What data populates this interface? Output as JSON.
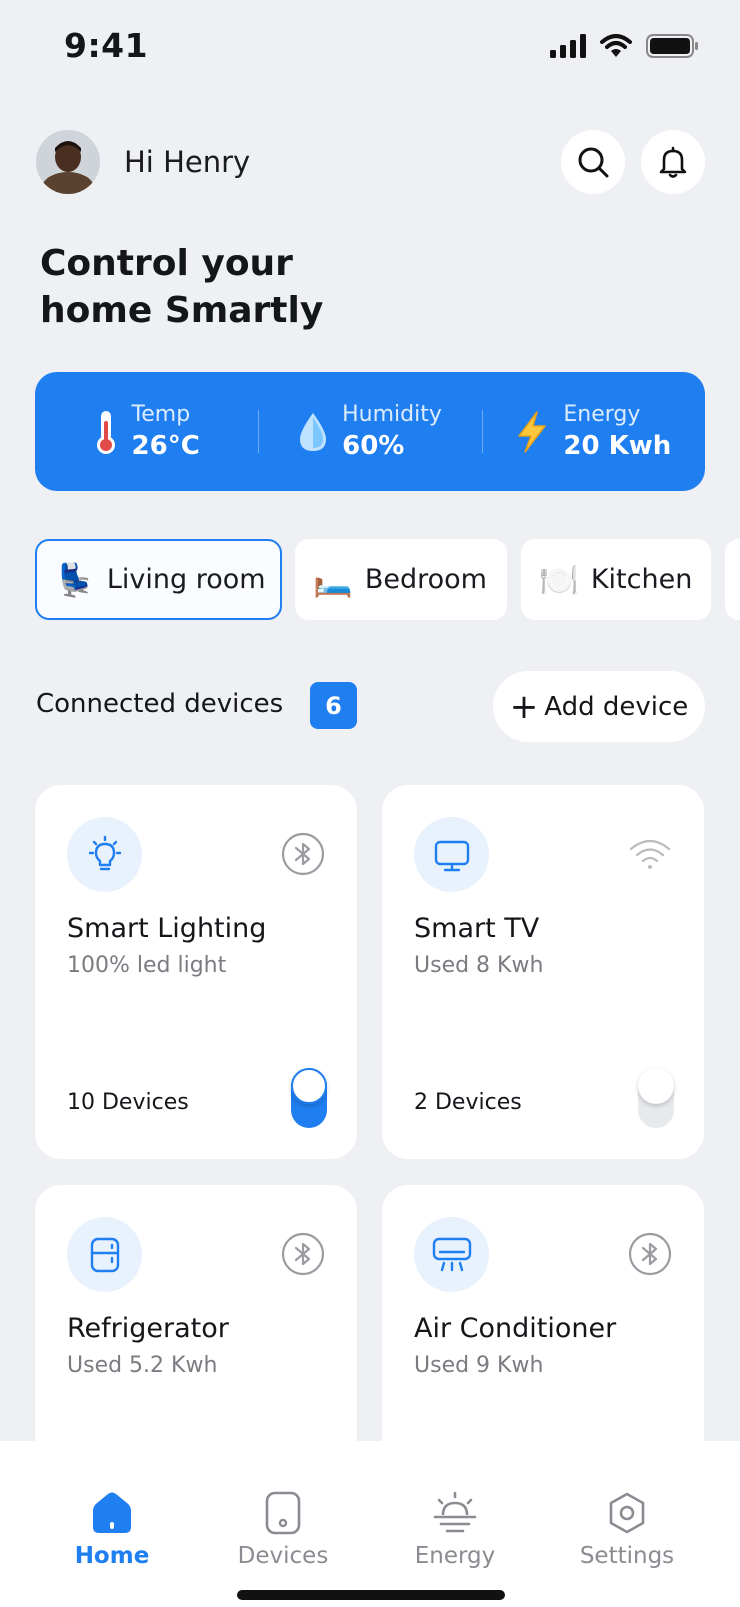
{
  "status_bar": {
    "time": "9:41",
    "icons": [
      "cellular-signal-icon",
      "wifi-icon",
      "battery-icon"
    ]
  },
  "header": {
    "greeting": "Hi Henry",
    "title_line1": "Control your",
    "title_line2": "home Smartly",
    "actions": [
      "search-icon",
      "bell-icon"
    ]
  },
  "stats": [
    {
      "icon": "thermometer-icon",
      "label": "Temp",
      "value": "26°C"
    },
    {
      "icon": "droplet-icon",
      "label": "Humidity",
      "value": "60%"
    },
    {
      "icon": "lightning-icon",
      "label": "Energy",
      "value": "20 Kwh"
    }
  ],
  "rooms": [
    {
      "label": "Living room",
      "emoji": "💺",
      "active": true
    },
    {
      "label": "Bedroom",
      "emoji": "🛏️",
      "active": false
    },
    {
      "label": "Kitchen",
      "emoji": "🍽️",
      "active": false
    }
  ],
  "connected": {
    "label": "Connected devices",
    "count": "6",
    "add_label": "Add device"
  },
  "devices": [
    {
      "name": "Smart Lighting",
      "sub": "100% led light",
      "count": "10 Devices",
      "icon": "lightbulb-icon",
      "connection": "bluetooth-icon",
      "on": true
    },
    {
      "name": "Smart TV",
      "sub": "Used 8 Kwh",
      "count": "2 Devices",
      "icon": "monitor-icon",
      "connection": "wifi-icon",
      "on": false
    },
    {
      "name": "Refrigerator",
      "sub": "Used 5.2 Kwh",
      "icon": "refrigerator-icon",
      "connection": "bluetooth-icon"
    },
    {
      "name": "Air Conditioner",
      "sub": "Used 9 Kwh",
      "icon": "air-conditioner-icon",
      "connection": "bluetooth-icon"
    }
  ],
  "nav": [
    {
      "label": "Home",
      "icon": "home-icon",
      "active": true
    },
    {
      "label": "Devices",
      "icon": "phone-device-icon",
      "active": false
    },
    {
      "label": "Energy",
      "icon": "sunrise-icon",
      "active": false
    },
    {
      "label": "Settings",
      "icon": "settings-hexagon-icon",
      "active": false
    }
  ],
  "colors": {
    "accent": "#1f7ef0",
    "background": "#eef0f3",
    "card": "#ffffff",
    "muted": "#7a7c82"
  }
}
